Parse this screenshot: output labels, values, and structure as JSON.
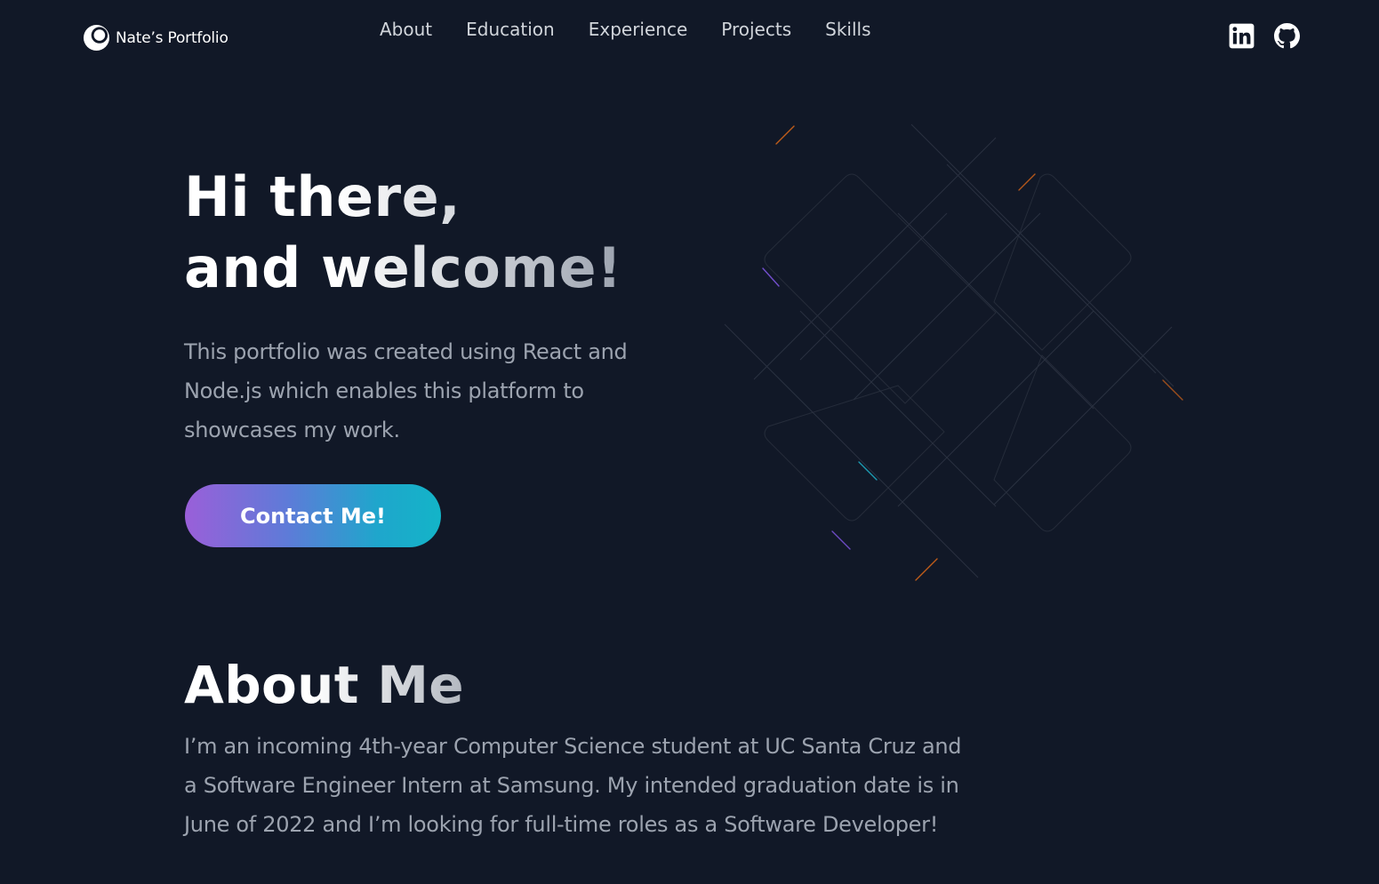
{
  "header": {
    "brand_name": "Nate’s Portfolio",
    "nav": [
      {
        "label": "About"
      },
      {
        "label": "Education"
      },
      {
        "label": "Experience"
      },
      {
        "label": "Projects"
      },
      {
        "label": "Skills"
      }
    ],
    "socials": [
      {
        "icon": "linkedin-icon"
      },
      {
        "icon": "github-icon"
      }
    ]
  },
  "hero": {
    "title_line1": "Hi there,",
    "title_line2": "and welcome!",
    "description": "This portfolio was created using React and Node.js which enables this platform to showcases my work.",
    "cta_label": "Contact Me!"
  },
  "about": {
    "title": "About Me",
    "text": "I’m an incoming 4th-year Computer Science student at UC Santa Cruz and a Software Engineer Intern at Samsung. My intended graduation date is in June of 2022 and I’m looking for full-time roles as a Software Developer!"
  },
  "colors": {
    "background": "#111827",
    "text_primary": "#ffffff",
    "text_muted": "#9ca3af",
    "nav_text": "#d1d5db",
    "cta_gradient_start": "#9a5fd9",
    "cta_gradient_end": "#13b4c8",
    "accent_orange": "#f97316",
    "accent_purple": "#8b5cf6",
    "accent_cyan": "#22d3ee"
  }
}
